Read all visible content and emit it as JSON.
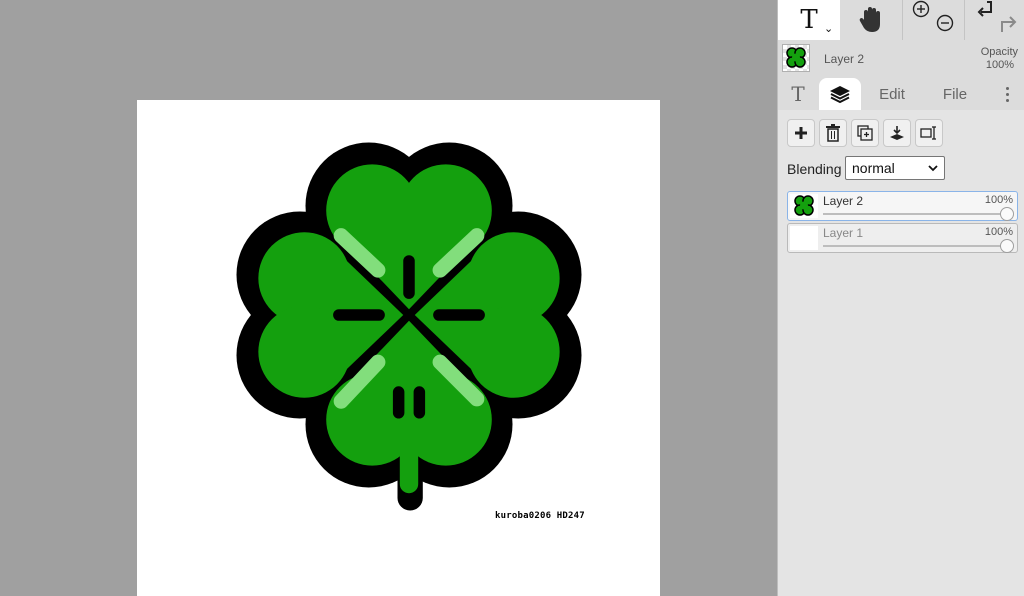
{
  "canvas": {
    "watermark": "kuroba0206 HD247"
  },
  "toolbar": {
    "text_tool_glyph": "T",
    "hand_tool_icon": "hand-icon",
    "zoom_in_icon": "zoom-in-icon",
    "zoom_out_icon": "zoom-out-icon",
    "undo_icon": "undo-icon",
    "redo_icon": "redo-icon"
  },
  "layer_header": {
    "name": "Layer 2",
    "opacity_label": "Opacity",
    "opacity_value": "100%"
  },
  "tabs": [
    {
      "label": "T"
    },
    {
      "label": "",
      "icon": "layers-icon"
    },
    {
      "label": "Edit"
    },
    {
      "label": "File"
    }
  ],
  "layer_actions": [
    "add-layer-icon",
    "delete-layer-icon",
    "duplicate-layer-icon",
    "merge-down-icon",
    "layer-properties-icon"
  ],
  "blending": {
    "label": "Blending",
    "value": "normal"
  },
  "layers": [
    {
      "name": "Layer 2",
      "opacity": "100%",
      "opacity_level": 1.0,
      "active": true
    },
    {
      "name": "Layer 1",
      "opacity": "100%",
      "opacity_level": 1.0,
      "active": false
    }
  ],
  "colors": {
    "clover": "#14a00e",
    "outline": "#000000",
    "highlight": "#82de7c",
    "panel": "#dcdcdc",
    "workspace": "#a0a0a0"
  }
}
